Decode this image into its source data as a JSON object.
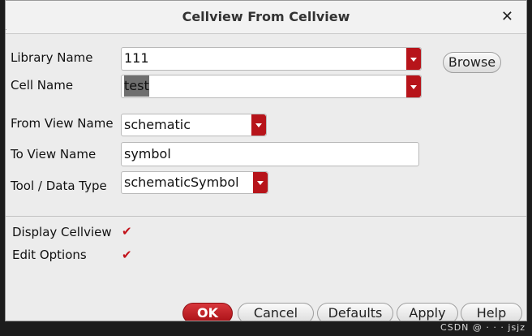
{
  "dialog": {
    "title": "Cellview From Cellview",
    "close_glyph": "✕",
    "fields": {
      "library_name": {
        "label": "Library Name",
        "value": "111"
      },
      "cell_name": {
        "label": "Cell Name",
        "value": "test"
      },
      "from_view_name": {
        "label": "From View Name",
        "value": "schematic"
      },
      "to_view_name": {
        "label": "To View Name",
        "value": "symbol"
      },
      "tool_data_type": {
        "label": "Tool / Data Type",
        "value": "schematicSymbol"
      }
    },
    "browse_label": "Browse",
    "options": {
      "display_cellview": {
        "label": "Display Cellview",
        "checked": true
      },
      "edit_options": {
        "label": "Edit Options",
        "checked": true
      }
    },
    "check_glyph": "✔",
    "buttons": {
      "ok": "OK",
      "cancel": "Cancel",
      "defaults": "Defaults",
      "apply": "Apply",
      "help": "Help"
    }
  },
  "watermark": "CSDN @ · · · jsjz"
}
